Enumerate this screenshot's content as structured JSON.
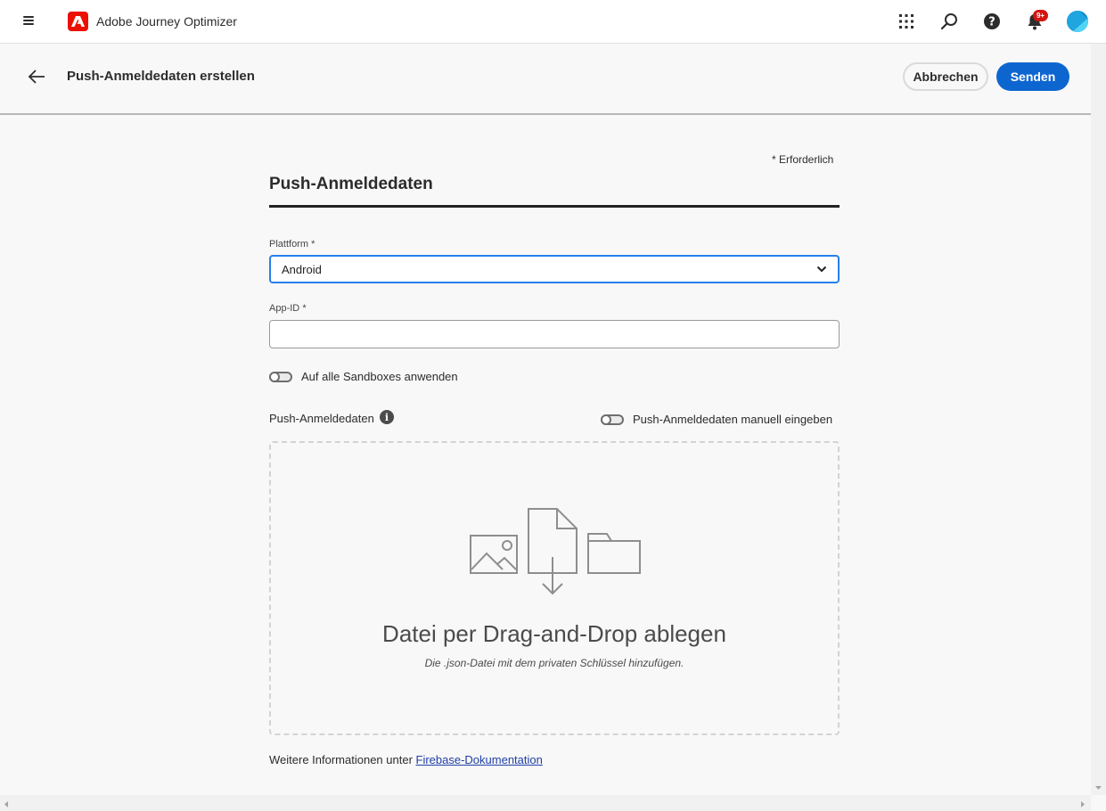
{
  "topbar": {
    "app_title": "Adobe Journey Optimizer",
    "notification_badge": "9+",
    "icons": [
      "menu-icon",
      "adobe-logo-icon",
      "apps-grid-icon",
      "search-icon",
      "help-icon",
      "bell-icon",
      "avatar"
    ]
  },
  "header": {
    "title": "Push-Anmeldedaten erstellen",
    "cancel_label": "Abbrechen",
    "send_label": "Senden"
  },
  "form": {
    "required_note": "* Erforderlich",
    "section_title": "Push-Anmeldedaten",
    "platform_label": "Plattform",
    "platform_value": "Android",
    "app_id_label": "App-ID",
    "app_id_value": "",
    "required_mark": "*",
    "sandbox_toggle_label": "Auf alle Sandboxes anwenden",
    "credentials_label": "Push-Anmeldedaten",
    "manual_toggle_label": "Push-Anmeldedaten manuell eingeben",
    "dropzone_title": "Datei per Drag-and-Drop ablegen",
    "dropzone_subtitle": "Die .json-Datei mit dem privaten Schlüssel hinzufügen.",
    "footer_prefix": "Weitere Informationen unter ",
    "footer_link": "Firebase-Dokumentation"
  },
  "colors": {
    "accent": "#0d66d0",
    "adobe_red": "#eb1000",
    "badge": "#d31510"
  }
}
